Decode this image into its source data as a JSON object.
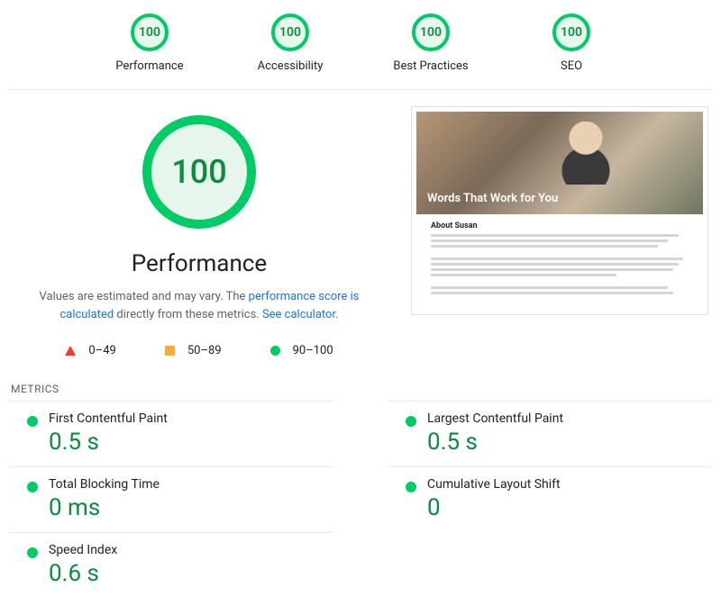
{
  "scores": [
    {
      "label": "Performance",
      "value": "100"
    },
    {
      "label": "Accessibility",
      "value": "100"
    },
    {
      "label": "Best Practices",
      "value": "100"
    },
    {
      "label": "SEO",
      "value": "100"
    }
  ],
  "hero": {
    "score": "100",
    "title": "Performance",
    "subtext_a": "Values are estimated and may vary. The ",
    "link_a": "performance score is calculated",
    "subtext_b": " directly from these metrics. ",
    "link_b": "See calculator."
  },
  "legend": {
    "low": "0–49",
    "mid": "50–89",
    "high": "90–100"
  },
  "thumbnail": {
    "hero_title": "Words That Work for You",
    "section_title": "About Susan"
  },
  "metrics_label": "METRICS",
  "metrics": [
    {
      "name": "First Contentful Paint",
      "value": "0.5 s"
    },
    {
      "name": "Largest Contentful Paint",
      "value": "0.5 s"
    },
    {
      "name": "Total Blocking Time",
      "value": "0 ms"
    },
    {
      "name": "Cumulative Layout Shift",
      "value": "0"
    },
    {
      "name": "Speed Index",
      "value": "0.6 s"
    }
  ]
}
